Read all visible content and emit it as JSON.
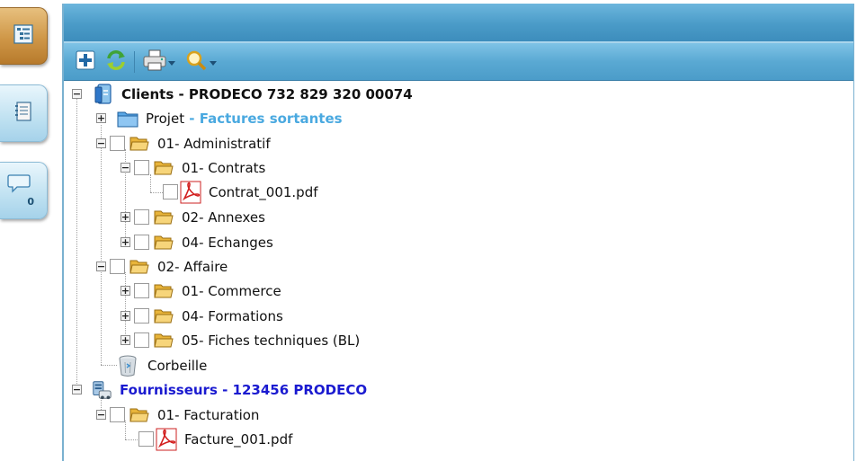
{
  "side_tabs": [
    {
      "name": "tree-view",
      "icon": "tree-list-icon",
      "active": true
    },
    {
      "name": "notes",
      "icon": "notebook-icon",
      "active": false
    },
    {
      "name": "comments",
      "icon": "speech-bubble-icon",
      "active": false,
      "badge": "0"
    }
  ],
  "toolbar": {
    "buttons": [
      "add-icon",
      "refresh-icon",
      "print-icon",
      "search-icon"
    ]
  },
  "tree": {
    "clients": {
      "label": "Clients - PRODECO 732 829 320 00074"
    },
    "projet": {
      "label": "Projet",
      "suffix": " - Factures sortantes"
    },
    "administratif": {
      "label": "01- Administratif"
    },
    "contrats": {
      "label": "01- Contrats"
    },
    "contrat_file": {
      "label": "Contrat_001.pdf"
    },
    "annexes": {
      "label": "02- Annexes"
    },
    "echanges": {
      "label": "04- Echanges"
    },
    "affaire": {
      "label": "02- Affaire"
    },
    "commerce": {
      "label": "01- Commerce"
    },
    "formations": {
      "label": "04- Formations"
    },
    "fiches": {
      "label": "05- Fiches techniques (BL)"
    },
    "corbeille": {
      "label": "Corbeille"
    },
    "fournisseurs": {
      "label": "Fournisseurs - 123456 PRODECO"
    },
    "facturation": {
      "label": "01- Facturation"
    },
    "facture_file": {
      "label": "Facture_001.pdf"
    }
  },
  "colors": {
    "header_blue": "#4a9bc8",
    "link_blue": "#1a1ad0",
    "light_blue": "#4aa9e0",
    "active_tab": "#cf9747"
  }
}
